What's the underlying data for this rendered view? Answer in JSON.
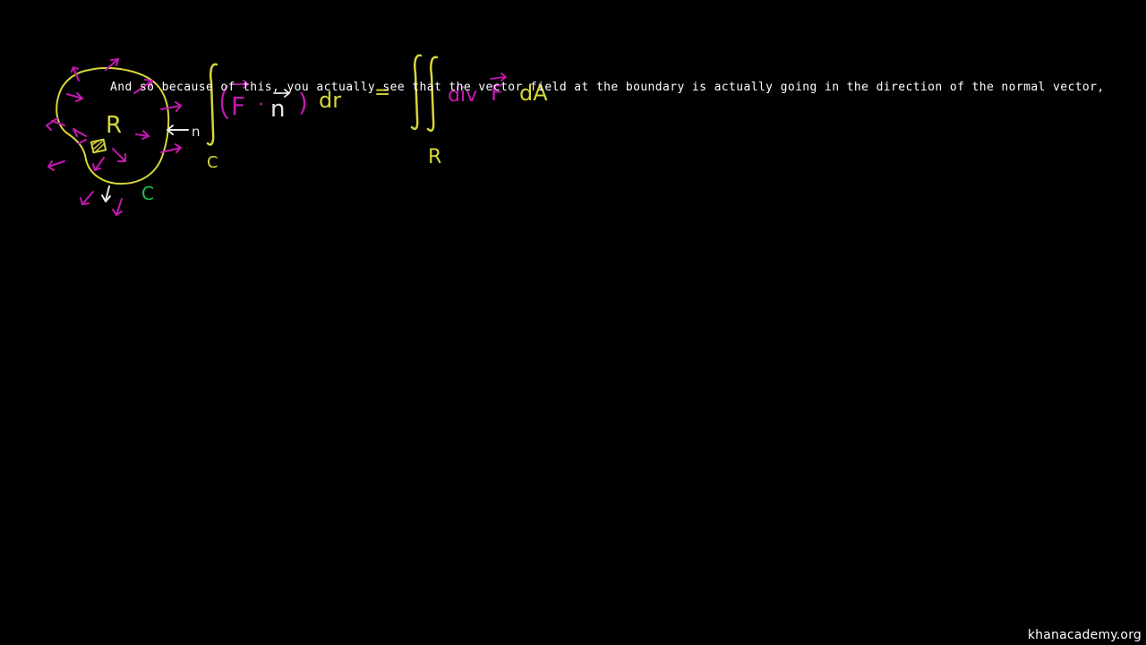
{
  "board": {
    "region_label": "R",
    "normal_label": "n",
    "curve_label": "C",
    "lhs_lower_limit": "C",
    "rhs_lower_limit": "R",
    "lhs_integrand_F": "F",
    "lhs_dot": "·",
    "lhs_normal": "n",
    "lhs_close_paren": ")",
    "lhs_differential": "dr",
    "equals_sign": "=",
    "rhs_div": "div",
    "rhs_F": "F",
    "rhs_dA": "dA",
    "colors": {
      "background": "#000000",
      "yellow": "#d6d63a",
      "magenta": "#c419b0",
      "white": "#e6e6e6",
      "green": "#1fbf4f"
    }
  },
  "subtitle": {
    "text": "And so because of this, you actually see that the vector field at the boundary is actually going in the direction of the normal vector,"
  },
  "watermark": {
    "text": "khanacademy.org"
  }
}
